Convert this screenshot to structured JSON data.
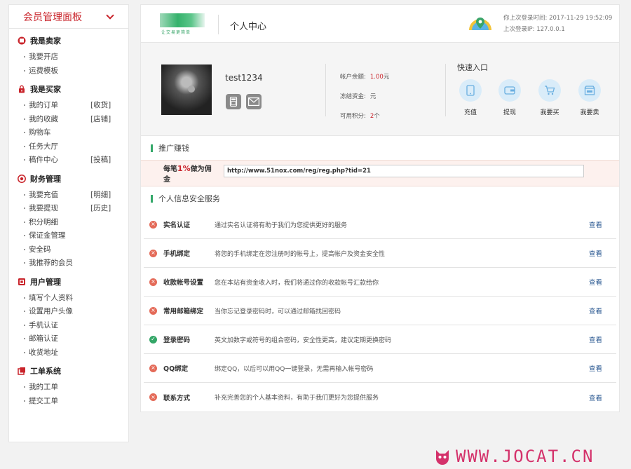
{
  "sidebar": {
    "title": "会员管理面板",
    "sections": [
      {
        "title": "我是卖家",
        "icon": "shop-icon",
        "items": [
          {
            "label": "我要开店",
            "extra": ""
          },
          {
            "label": "运费模板",
            "extra": ""
          }
        ]
      },
      {
        "title": "我是买家",
        "icon": "lock-icon",
        "items": [
          {
            "label": "我的订单",
            "extra": "[收货]"
          },
          {
            "label": "我的收藏",
            "extra": "[店铺]"
          },
          {
            "label": "购物车",
            "extra": ""
          },
          {
            "label": "任务大厅",
            "extra": ""
          },
          {
            "label": "稿件中心",
            "extra": "[投稿]"
          }
        ]
      },
      {
        "title": "财务管理",
        "icon": "coin-icon",
        "items": [
          {
            "label": "我要充值",
            "extra": "[明细]"
          },
          {
            "label": "我要提现",
            "extra": "[历史]"
          },
          {
            "label": "积分明细",
            "extra": ""
          },
          {
            "label": "保证金管理",
            "extra": ""
          },
          {
            "label": "安全码",
            "extra": ""
          },
          {
            "label": "我推荐的会员",
            "extra": ""
          }
        ]
      },
      {
        "title": "用户管理",
        "icon": "user-card-icon",
        "items": [
          {
            "label": "填写个人资料",
            "extra": ""
          },
          {
            "label": "设置用户头像",
            "extra": ""
          },
          {
            "label": "手机认证",
            "extra": ""
          },
          {
            "label": "邮箱认证",
            "extra": ""
          },
          {
            "label": "收货地址",
            "extra": ""
          }
        ]
      },
      {
        "title": "工单系统",
        "icon": "ticket-icon",
        "items": [
          {
            "label": "我的工单",
            "extra": ""
          },
          {
            "label": "提交工单",
            "extra": ""
          }
        ]
      }
    ]
  },
  "header": {
    "logo_sub": "让交易更简单",
    "title": "个人中心",
    "last_login_time": "你上次登录时间: 2017-11-29 19:52:09",
    "last_login_ip": "上次登录IP: 127.0.0.1"
  },
  "profile": {
    "username": "test1234",
    "balance_label": "帐户余额:",
    "balance_value": "1.00",
    "balance_unit": "元",
    "frozen_label": "冻结资金:",
    "frozen_unit": "元",
    "points_label": "可用积分:",
    "points_value": "2",
    "points_unit": "个"
  },
  "quick": {
    "title": "快速入口",
    "items": [
      {
        "label": "充值",
        "icon": "phone-icon"
      },
      {
        "label": "提现",
        "icon": "wallet-icon"
      },
      {
        "label": "我要买",
        "icon": "cart-icon"
      },
      {
        "label": "我要卖",
        "icon": "shop-sell-icon"
      }
    ]
  },
  "promo": {
    "section_title": "推广赚钱",
    "label_pre": "每笔",
    "label_pct": "1%",
    "label_post": "做为佣金",
    "url": "http://www.51nox.com/reg/reg.php?tid=21"
  },
  "security": {
    "section_title": "个人信息安全服务",
    "link_label": "查看",
    "rows": [
      {
        "name": "实名认证",
        "desc": "通过实名认证将有助于我们为您提供更好的服务",
        "ok": false
      },
      {
        "name": "手机绑定",
        "desc": "将您的手机绑定在您注册时的帐号上，提高帐户及资金安全性",
        "ok": false
      },
      {
        "name": "收款帐号设置",
        "desc": "您在本站有资金收入时，我们将通过你的收款帐号汇款给你",
        "ok": false
      },
      {
        "name": "常用邮箱绑定",
        "desc": "当你忘记登录密码时，可以通过邮箱找回密码",
        "ok": false
      },
      {
        "name": "登录密码",
        "desc": "英文加数字或符号的组合密码，安全性更高，建议定期更换密码",
        "ok": true
      },
      {
        "name": "QQ绑定",
        "desc": "绑定QQ，以后可以用QQ一键登录，无需再输入帐号密码",
        "ok": false
      },
      {
        "name": "联系方式",
        "desc": "补充完善您的个人基本资料，有助于我们更好为您提供服务",
        "ok": false
      }
    ]
  },
  "watermark": "WWW.JOCAT.CN",
  "colors": {
    "brand_red": "#c9242b",
    "accent_green": "#35a86a",
    "link_blue": "#2e5b93",
    "error_red": "#e46a58",
    "ok_green": "#33a667"
  }
}
